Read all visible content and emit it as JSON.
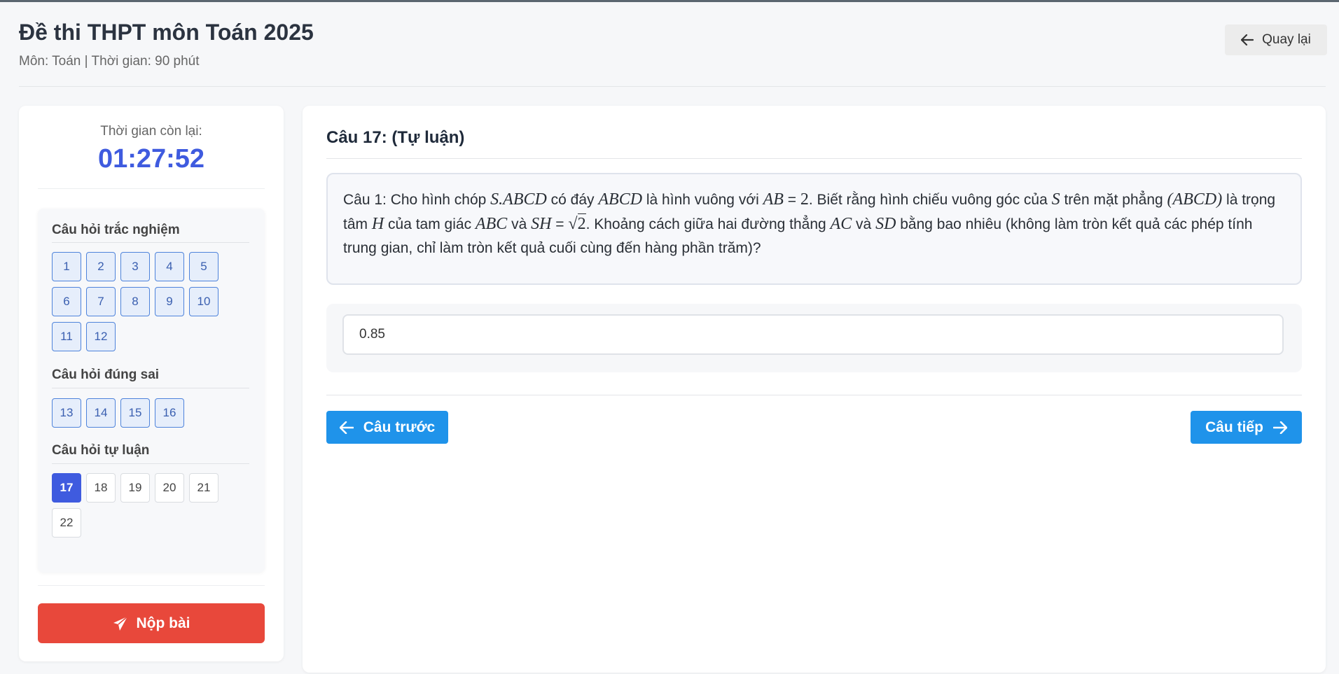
{
  "header": {
    "title": "Đề thi THPT môn Toán 2025",
    "subtitle": "Môn: Toán | Thời gian: 90 phút",
    "back_label": "Quay lại"
  },
  "timer": {
    "label": "Thời gian còn lại:",
    "value": "01:27:52"
  },
  "sections": [
    {
      "title": "Câu hỏi trắc nghiệm",
      "questions": [
        "1",
        "2",
        "3",
        "4",
        "5",
        "6",
        "7",
        "8",
        "9",
        "10",
        "11",
        "12"
      ],
      "state": "answered"
    },
    {
      "title": "Câu hỏi đúng sai",
      "questions": [
        "13",
        "14",
        "15",
        "16"
      ],
      "state": "answered"
    },
    {
      "title": "Câu hỏi tự luận",
      "questions": [
        "17",
        "18",
        "19",
        "20",
        "21",
        "22"
      ],
      "current": "17"
    }
  ],
  "submit_label": "Nộp bài",
  "question": {
    "heading": "Câu 17: (Tự luận)",
    "t1": "Câu 1: Cho hình chóp ",
    "m1": "S.ABCD",
    "t2": " có đáy ",
    "m2": "ABCD",
    "t3": " là hình vuông với ",
    "m3": "AB",
    "t4": " = ",
    "n1": "2",
    "t5": ". Biết rằng hình chiếu vuông góc của ",
    "m4": "S",
    "t6": " trên mặt phẳng ",
    "m5": "(ABCD)",
    "t7": " là trọng tâm ",
    "m6": "H",
    "t8": " của tam giác ",
    "m7": "ABC",
    "t9": " và ",
    "m8": "SH",
    "t10": " = ",
    "sqrt_symbol": "√",
    "sqrt_arg": "2",
    "t11": ". Khoảng cách giữa hai đường thẳng ",
    "m9": "AC",
    "t12": " và ",
    "m10": "SD",
    "t13": " bằng bao nhiêu (không làm tròn kết quả các phép tính trung gian, chỉ làm tròn kết quả cuối cùng đến hàng phần trăm)?"
  },
  "answer": {
    "value": "0.85"
  },
  "nav": {
    "prev_label": "Câu trước",
    "next_label": "Câu tiếp"
  },
  "colors": {
    "primary": "#1f93ea",
    "current": "#3f5bdf",
    "submit": "#e8483b",
    "timer": "#3f5bdf"
  }
}
